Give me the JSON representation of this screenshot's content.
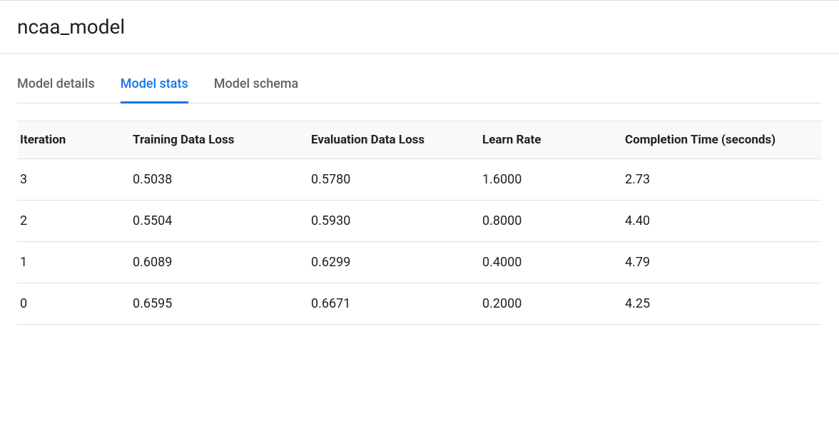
{
  "header": {
    "title": "ncaa_model"
  },
  "tabs": [
    {
      "label": "Model details",
      "active": false
    },
    {
      "label": "Model stats",
      "active": true
    },
    {
      "label": "Model schema",
      "active": false
    }
  ],
  "table": {
    "headers": {
      "iteration": "Iteration",
      "training_loss": "Training Data Loss",
      "eval_loss": "Evaluation Data Loss",
      "learn_rate": "Learn Rate",
      "completion_time": "Completion Time (seconds)"
    },
    "rows": [
      {
        "iteration": "3",
        "training_loss": "0.5038",
        "eval_loss": "0.5780",
        "learn_rate": "1.6000",
        "completion_time": "2.73"
      },
      {
        "iteration": "2",
        "training_loss": "0.5504",
        "eval_loss": "0.5930",
        "learn_rate": "0.8000",
        "completion_time": "4.40"
      },
      {
        "iteration": "1",
        "training_loss": "0.6089",
        "eval_loss": "0.6299",
        "learn_rate": "0.4000",
        "completion_time": "4.79"
      },
      {
        "iteration": "0",
        "training_loss": "0.6595",
        "eval_loss": "0.6671",
        "learn_rate": "0.2000",
        "completion_time": "4.25"
      }
    ]
  }
}
